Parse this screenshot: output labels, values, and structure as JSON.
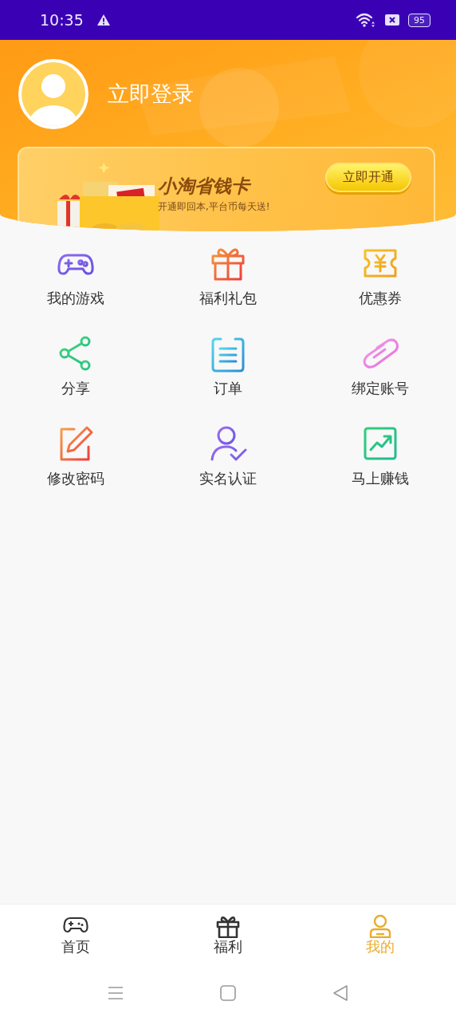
{
  "status_bar": {
    "time": "10:35",
    "battery": "95"
  },
  "profile": {
    "login_text": "立即登录"
  },
  "banner": {
    "title": "小淘省钱卡",
    "subtitle": "开通即回本,平台币每天送!",
    "button": "立即开通"
  },
  "menu_items": [
    {
      "label": "我的游戏"
    },
    {
      "label": "福利礼包"
    },
    {
      "label": "优惠券"
    },
    {
      "label": "分享"
    },
    {
      "label": "订单"
    },
    {
      "label": "绑定账号"
    },
    {
      "label": "修改密码"
    },
    {
      "label": "实名认证"
    },
    {
      "label": "马上赚钱"
    }
  ],
  "bottom_nav": [
    {
      "label": "首页",
      "selected": false
    },
    {
      "label": "福利",
      "selected": false
    },
    {
      "label": "我的",
      "selected": true
    }
  ]
}
